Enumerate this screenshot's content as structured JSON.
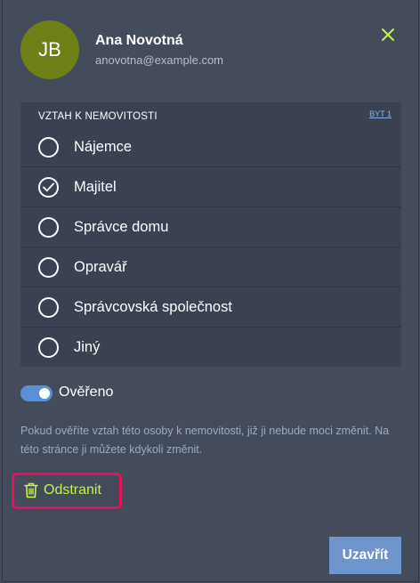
{
  "user": {
    "initials": "JB",
    "name": "Ana Novotná",
    "email": "anovotna@example.com",
    "avatar_color": "#6e7f18"
  },
  "close_icon": "close-icon",
  "relationship": {
    "title": "VZTAH K NEMOVITOSTI",
    "link": "BYT 1",
    "selected": "Majitel",
    "options": [
      {
        "label": "Nájemce",
        "checked": false
      },
      {
        "label": "Majitel",
        "checked": true
      },
      {
        "label": "Správce domu",
        "checked": false
      },
      {
        "label": "Opravář",
        "checked": false
      },
      {
        "label": "Správcovská společnost",
        "checked": false
      },
      {
        "label": "Jiný",
        "checked": false
      }
    ]
  },
  "verified": {
    "label": "Ověřeno",
    "on": true
  },
  "help_text": "Pokud ověříte vztah této osoby k nemovitosti, již ji nebude moci změnit. Na této stránce ji můžete kdykoli změnit.",
  "delete": {
    "label": "Odstranit",
    "icon": "trash-icon"
  },
  "footer": {
    "close_label": "Uzavřít"
  },
  "colors": {
    "background": "#444c5c",
    "panel": "#3a4151",
    "accent": "#c8f04e",
    "primary_button": "#6e96cc",
    "toggle": "#5a8fd6",
    "highlight_border": "#e4145b"
  }
}
